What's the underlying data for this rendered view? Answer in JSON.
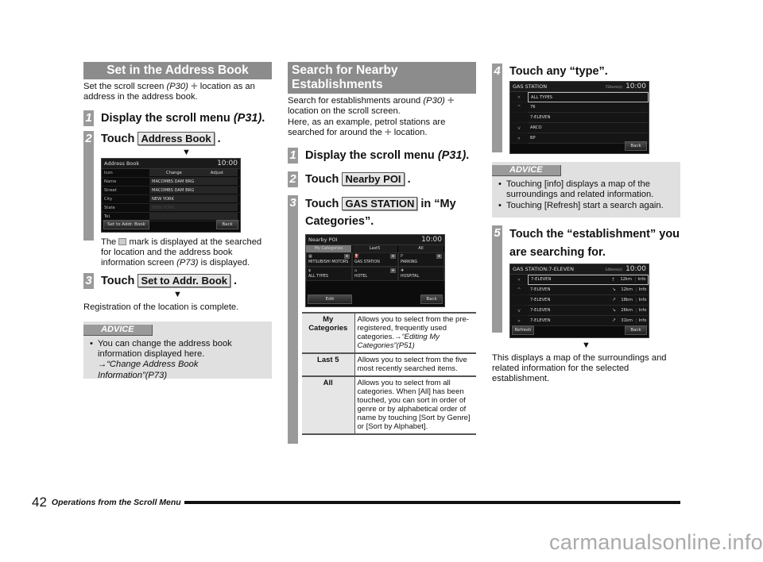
{
  "col1": {
    "title": "Set in the Address Book",
    "intro_a": "Set the scroll screen ",
    "intro_ref": "(P30)",
    "intro_b": " location as an address in the address book.",
    "step1": {
      "num": "1",
      "text": "Display the scroll menu ",
      "ref": "(P31)",
      "end": "."
    },
    "step2": {
      "num": "2",
      "touch": "Touch ",
      "button": "Address Book",
      "end": " ."
    },
    "screen": {
      "title": "Address Book",
      "time": "10:00",
      "rows": [
        {
          "label": "Icon",
          "value": ""
        },
        {
          "label": "Name",
          "value": "MACOMBS DAM BRG"
        },
        {
          "label": "Street",
          "value": "MACOMBS DAM BRG"
        },
        {
          "label": "City",
          "value": "NEW YORK"
        },
        {
          "label": "State",
          "value": "NEW YORK"
        },
        {
          "label": "Tel.",
          "value": ""
        }
      ],
      "icon_change": "Change",
      "icon_adjust": "Adjust",
      "btn_left": "Set to Addr. Book",
      "btn_right": "Back"
    },
    "note_a": "The ",
    "note_b": " mark is displayed at the searched for location and the address book information screen ",
    "note_ref": "(P73)",
    "note_c": " is displayed.",
    "step3": {
      "num": "3",
      "touch": "Touch ",
      "button": "Set to Addr. Book",
      "end": " ."
    },
    "result": "Registration of the location is complete.",
    "advice": {
      "tag": "ADVICE",
      "item": "You can change the address book information displayed here.",
      "link": "→“Change Address Book Information”(P73)"
    }
  },
  "col2": {
    "title": "Search for Nearby Establishments",
    "intro_a": "Search for establishments around ",
    "intro_ref": "(P30)",
    "intro_b": " location on the scroll screen.",
    "intro_c": "Here, as an example, petrol stations are searched for around the ",
    "intro_d": " location.",
    "step1": {
      "num": "1",
      "text": "Display the scroll menu ",
      "ref": "(P31)",
      "end": "."
    },
    "step2": {
      "num": "2",
      "touch": "Touch ",
      "button": "Nearby POI",
      "end": " ."
    },
    "step3": {
      "num": "3",
      "touch": "Touch ",
      "button": "GAS STATION",
      "end": " in “My Categories”."
    },
    "screen": {
      "title": "Nearby POI",
      "time": "10:00",
      "tabs": [
        "My Categories",
        "Last5",
        "All"
      ],
      "cells": [
        {
          "icon": "▦",
          "name": "MITSUBISHI MOTORS",
          "plus": true
        },
        {
          "icon": "⛽",
          "name": "GAS STATION",
          "plus": true
        },
        {
          "icon": "P",
          "name": "PARKING",
          "plus": true
        },
        {
          "icon": "ψ",
          "name": "ALL TYPES",
          "plus": false
        },
        {
          "icon": "⌂",
          "name": "HOTEL",
          "plus": true
        },
        {
          "icon": "✚",
          "name": "HOSPITAL",
          "plus": false
        }
      ],
      "btn_left": "Edit",
      "btn_right": "Back"
    },
    "table": [
      {
        "key": "My Categories",
        "value": "Allows you to select from the pre-registered, frequently used categories.",
        "link": "→“Editing My Categories”(P51)"
      },
      {
        "key": "Last 5",
        "value": "Allows you to select from the five most recently searched items.",
        "link": ""
      },
      {
        "key": "All",
        "value": "Allows you to select from all categories. When [All] has been touched, you can sort in order of genre or by alphabetical order of name by touching [Sort by Genre] or [Sort by Alphabet].",
        "link": ""
      }
    ]
  },
  "col3": {
    "step4": {
      "num": "4",
      "text": "Touch any “type”."
    },
    "screen4": {
      "title": "GAS STATION",
      "count": "72item(s)",
      "time": "10:00",
      "side": [
        "«",
        "^",
        "",
        "v",
        "»"
      ],
      "items": [
        "ALL TYPES",
        "76",
        "7-ELEVEN",
        "ARCO",
        "BP"
      ],
      "btn_right": "Back"
    },
    "advice": {
      "tag": "ADVICE",
      "items": [
        "Touching [info] displays a map of the surroundings and related information.",
        "Touching [Refresh] start a search again."
      ]
    },
    "step5": {
      "num": "5",
      "text": "Touch the “establishment” you are searching for."
    },
    "screen5": {
      "title": "GAS STATION:7-ELEVEN",
      "count": "14item(s)",
      "time": "10:00",
      "side": [
        "«",
        "^",
        "",
        "v",
        "»"
      ],
      "items": [
        {
          "name": "7-ELEVEN",
          "dir": "↑",
          "dist": "12km",
          "info": "Info"
        },
        {
          "name": "7-ELEVEN",
          "dir": "↘",
          "dist": "12km",
          "info": "Info"
        },
        {
          "name": "7-ELEVEN",
          "dir": "↗",
          "dist": "18km",
          "info": "Info"
        },
        {
          "name": "7-ELEVEN",
          "dir": "↘",
          "dist": "26km",
          "info": "Info"
        },
        {
          "name": "7-ELEVEN",
          "dir": "↗",
          "dist": "31km",
          "info": "Info"
        }
      ],
      "btn_left": "Refresh",
      "btn_right": "Back"
    },
    "result": "This displays a map of the surroundings and related information for the selected establishment."
  },
  "footer": {
    "page": "42",
    "title": "Operations from the Scroll Menu"
  },
  "watermark": "carmanualsonline.info",
  "arrow": "▼",
  "plus_glyph": "+"
}
